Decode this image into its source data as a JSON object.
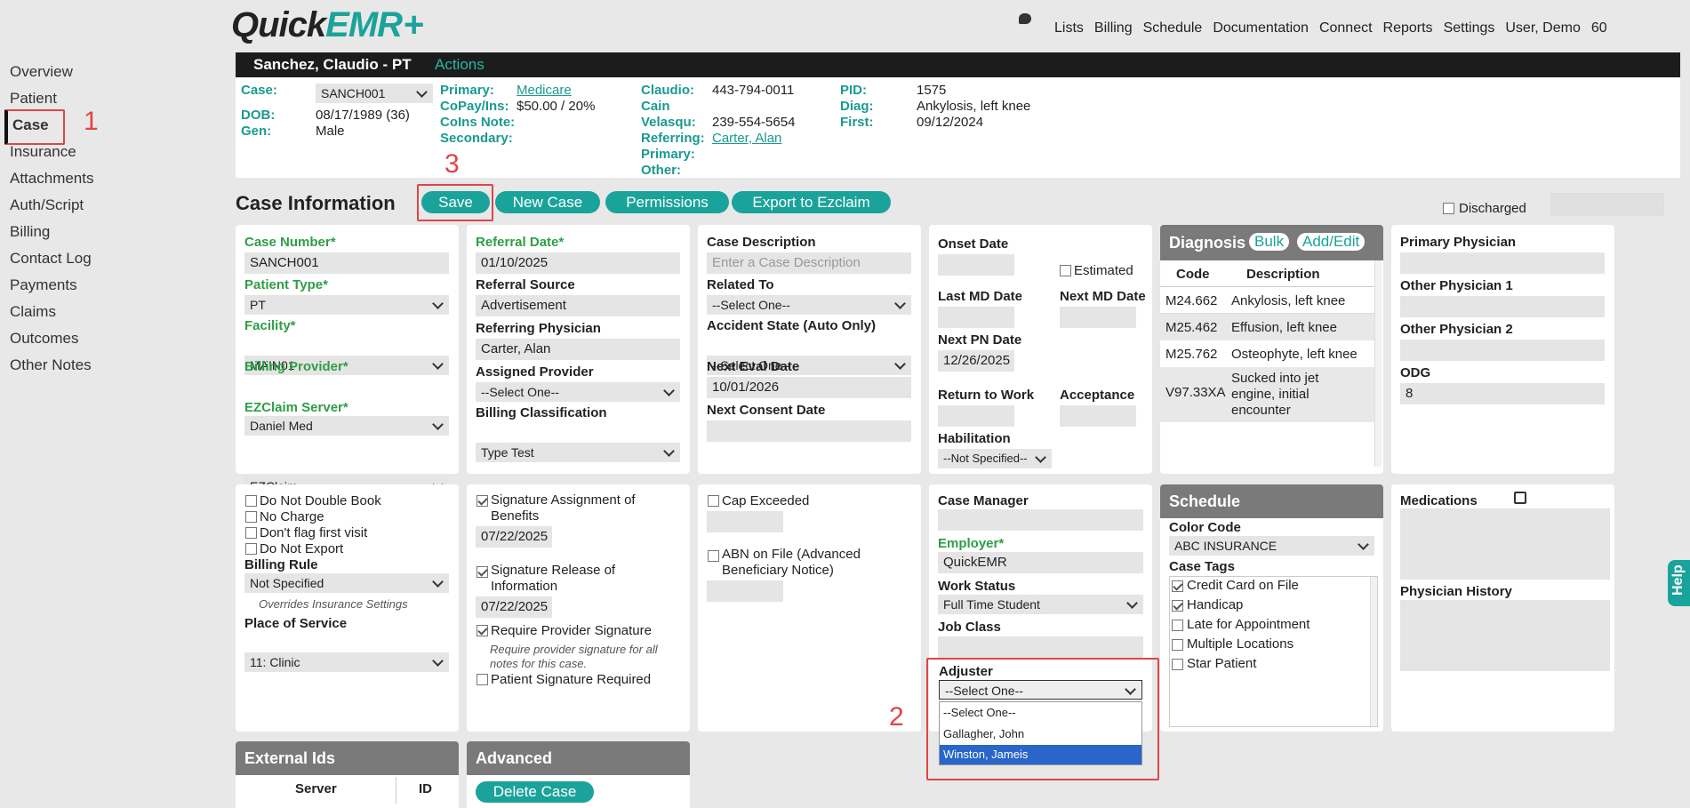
{
  "app": {
    "logo_part1": "Quick",
    "logo_part2": "EMR",
    "logo_plus": "+"
  },
  "topnav": [
    "Lists",
    "Billing",
    "Schedule",
    "Documentation",
    "Connect",
    "Reports",
    "Settings",
    "User, Demo",
    "60"
  ],
  "sidebar": [
    "Overview",
    "Patient",
    "Case",
    "Insurance",
    "Attachments",
    "Auth/Script",
    "Billing",
    "Contact Log",
    "Payments",
    "Claims",
    "Outcomes",
    "Other Notes"
  ],
  "annotations": {
    "n1": "1",
    "n2": "2",
    "n3": "3"
  },
  "patient_bar": {
    "name": "Sanchez, Claudio - PT",
    "actions": "Actions"
  },
  "info": {
    "case_label": "Case:",
    "case_value": "SANCH001",
    "dob_label": "DOB:",
    "dob_value": "08/17/1989 (36)",
    "gen_label": "Gen:",
    "gen_value": "Male",
    "primary_label": "Primary:",
    "primary_value": "Medicare",
    "copay_label": "CoPay/Ins:",
    "copay_value": "$50.00 / 20%",
    "coins_label": "CoIns Note:",
    "secondary_label": "Secondary:",
    "claudio_label": "Claudio:",
    "claudio_value": "443-794-0011",
    "cain_label": "Cain",
    "velasqu_label": "Velasqu:",
    "velasqu_value": "239-554-5654",
    "referring_label": "Referring:",
    "referring_value": "Carter, Alan",
    "primary2_label": "Primary:",
    "other_label": "Other:",
    "pid_label": "PID:",
    "pid_value": "1575",
    "diag_label": "Diag:",
    "diag_value": "Ankylosis, left knee",
    "first_label": "First:",
    "first_value": "09/12/2024"
  },
  "case_info": {
    "title": "Case Information",
    "buttons": {
      "save": "Save",
      "new_case": "New Case",
      "permissions": "Permissions",
      "export": "Export to Ezclaim"
    },
    "discharged": "Discharged"
  },
  "card1": {
    "case_number_label": "Case Number*",
    "case_number": "SANCH001",
    "patient_type_label": "Patient Type*",
    "patient_type": "PT",
    "facility_label": "Facility*",
    "facility": "MAIN01",
    "billing_provider_label": "Billing Provider*",
    "billing_provider": "Daniel Med",
    "ezclaim_label": "EZClaim Server*",
    "ezclaim": "EZClaim"
  },
  "card2": {
    "referral_date_label": "Referral Date*",
    "referral_date": "01/10/2025",
    "referral_source_label": "Referral Source",
    "referral_source": "Advertisement",
    "referring_physician_label": "Referring Physician",
    "referring_physician": "Carter, Alan",
    "assigned_provider_label": "Assigned Provider",
    "assigned_provider": "--Select One--",
    "billing_class_label": "Billing Classification",
    "billing_class": "Type Test"
  },
  "card3": {
    "desc_label": "Case Description",
    "desc_placeholder": "Enter a Case Description",
    "related_label": "Related To",
    "related": "--Select One--",
    "accident_label": "Accident State (Auto Only)",
    "accident": "--Select One--",
    "next_eval_label": "Next Eval Date",
    "next_eval": "10/01/2026",
    "next_consent_label": "Next Consent Date"
  },
  "card4": {
    "onset_label": "Onset Date",
    "estimated": "Estimated",
    "last_md_label": "Last MD Date",
    "next_md_label": "Next MD Date",
    "next_pn_label": "Next PN Date",
    "next_pn": "12/26/2025",
    "rtw_label": "Return to Work",
    "acceptance_label": "Acceptance",
    "habilitation_label": "Habilitation",
    "habilitation": "--Not Specified--"
  },
  "diagnosis": {
    "title": "Diagnosis",
    "bulk": "Bulk",
    "add_edit": "Add/Edit",
    "col_code": "Code",
    "col_desc": "Description",
    "rows": [
      {
        "code": "M24.662",
        "desc": "Ankylosis, left knee"
      },
      {
        "code": "M25.462",
        "desc": "Effusion, left knee"
      },
      {
        "code": "M25.762",
        "desc": "Osteophyte, left knee"
      },
      {
        "code": "V97.33XA",
        "desc": "Sucked into jet engine, initial encounter"
      }
    ]
  },
  "physicians": {
    "primary_label": "Primary Physician",
    "other1_label": "Other Physician 1",
    "other2_label": "Other Physician 2",
    "odg_label": "ODG",
    "odg": "8"
  },
  "row2_card1": {
    "do_not_double_book": "Do Not Double Book",
    "no_charge": "No Charge",
    "dont_flag": "Don't flag first visit",
    "do_not_export": "Do Not Export",
    "billing_rule_label": "Billing Rule",
    "billing_rule": "Not Specified",
    "overrides_note": "Overrides Insurance Settings",
    "pos_label": "Place of Service",
    "pos": "11: Clinic"
  },
  "row2_card2": {
    "sig_assign": "Signature Assignment of Benefits",
    "sig_assign_date": "07/22/2025",
    "sig_release": "Signature Release of Information",
    "sig_release_date": "07/22/2025",
    "req_provider": "Require Provider Signature",
    "req_provider_note": "Require provider signature for all notes for this case.",
    "patient_sig": "Patient Signature Required"
  },
  "row2_card3": {
    "cap_exceeded": "Cap Exceeded",
    "abn": "ABN on File (Advanced Beneficiary Notice)"
  },
  "row2_card4": {
    "case_manager_label": "Case Manager",
    "employer_label": "Employer*",
    "employer": "QuickEMR",
    "work_status_label": "Work Status",
    "work_status": "Full Time Student",
    "job_class_label": "Job Class",
    "adjuster_label": "Adjuster",
    "adjuster": "--Select One--",
    "adjuster_options": [
      "--Select One--",
      "Gallagher, John",
      "Winston, Jameis"
    ]
  },
  "schedule": {
    "title": "Schedule",
    "color_code_label": "Color Code",
    "color_code": "ABC INSURANCE",
    "case_tags_label": "Case Tags",
    "tags": [
      {
        "label": "Credit Card on File",
        "checked": true
      },
      {
        "label": "Handicap",
        "checked": true
      },
      {
        "label": "Late for Appointment",
        "checked": false
      },
      {
        "label": "Multiple Locations",
        "checked": false
      },
      {
        "label": "Star Patient",
        "checked": false
      }
    ]
  },
  "medications": {
    "label": "Medications",
    "physician_history_label": "Physician History"
  },
  "external_ids": {
    "title": "External Ids",
    "col_server": "Server",
    "col_id": "ID"
  },
  "advanced": {
    "title": "Advanced",
    "delete_case": "Delete Case"
  },
  "help": "Help",
  "colors": {
    "accent": "#1aa39a",
    "required_label": "#2e9e46",
    "highlight": "#e04545",
    "selected_option": "#2a65c9"
  }
}
